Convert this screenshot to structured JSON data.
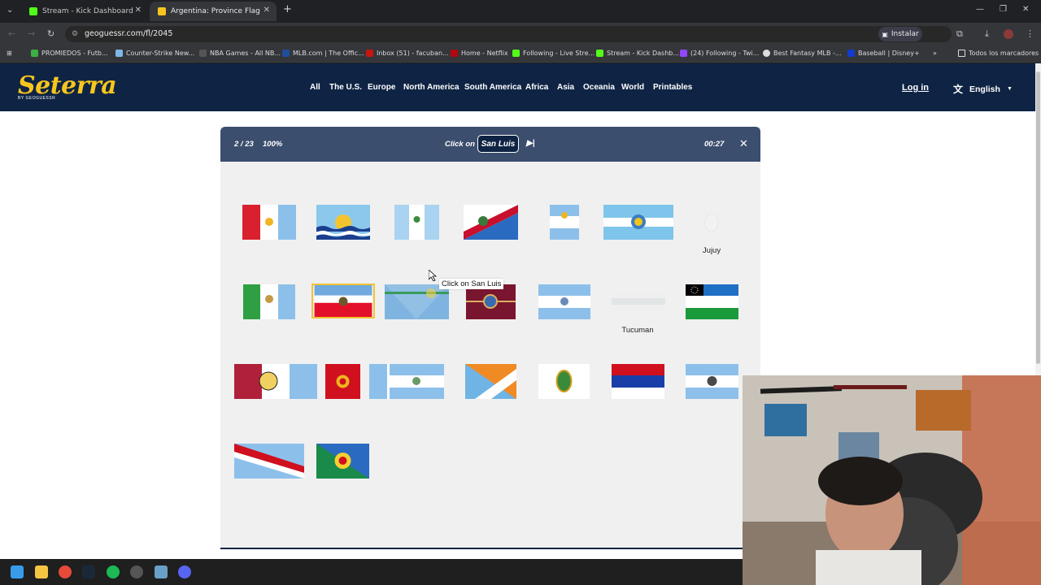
{
  "browser": {
    "tabs": [
      {
        "title": "Stream - Kick Dashboard",
        "active": false
      },
      {
        "title": "Argentina: Province Flags - Flag",
        "active": true
      }
    ],
    "url": "geoguessr.com/fl/2045",
    "install_label": "Instalar",
    "bookmarks": [
      "PROMIEDOS - Futb...",
      "Counter-Strike New...",
      "NBA Games - All NB...",
      "MLB.com | The Offic...",
      "Inbox (51) - facuban...",
      "Home - Netflix",
      "Following - Live Stre...",
      "Stream - Kick Dashb...",
      "(24) Following - Twi...",
      "Best Fantasy MLB -...",
      "Baseball | Disney+"
    ],
    "all_bookmarks_label": "Todos los marcadores"
  },
  "site": {
    "logo": "Seterra",
    "logo_sub": "BY GEOGUESSR",
    "nav": [
      "All",
      "The U.S.",
      "Europe",
      "North America",
      "South America",
      "Africa",
      "Asia",
      "Oceania",
      "World",
      "Printables"
    ],
    "login": "Log in",
    "language": "English"
  },
  "game": {
    "progress": "2 / 23",
    "score": "100%",
    "prompt_prefix": "Click on",
    "target": "San Luis",
    "timer": "00:27",
    "tooltip": "Click on San Luis",
    "placed_labels": {
      "jujuy": "Jujuy",
      "tucuman": "Tucuman"
    }
  },
  "colors": {
    "header": "#0f2444",
    "accent_yellow": "#f7c51e",
    "game_bar": "#3c4e6e",
    "game_bg": "#f0f0f0"
  }
}
